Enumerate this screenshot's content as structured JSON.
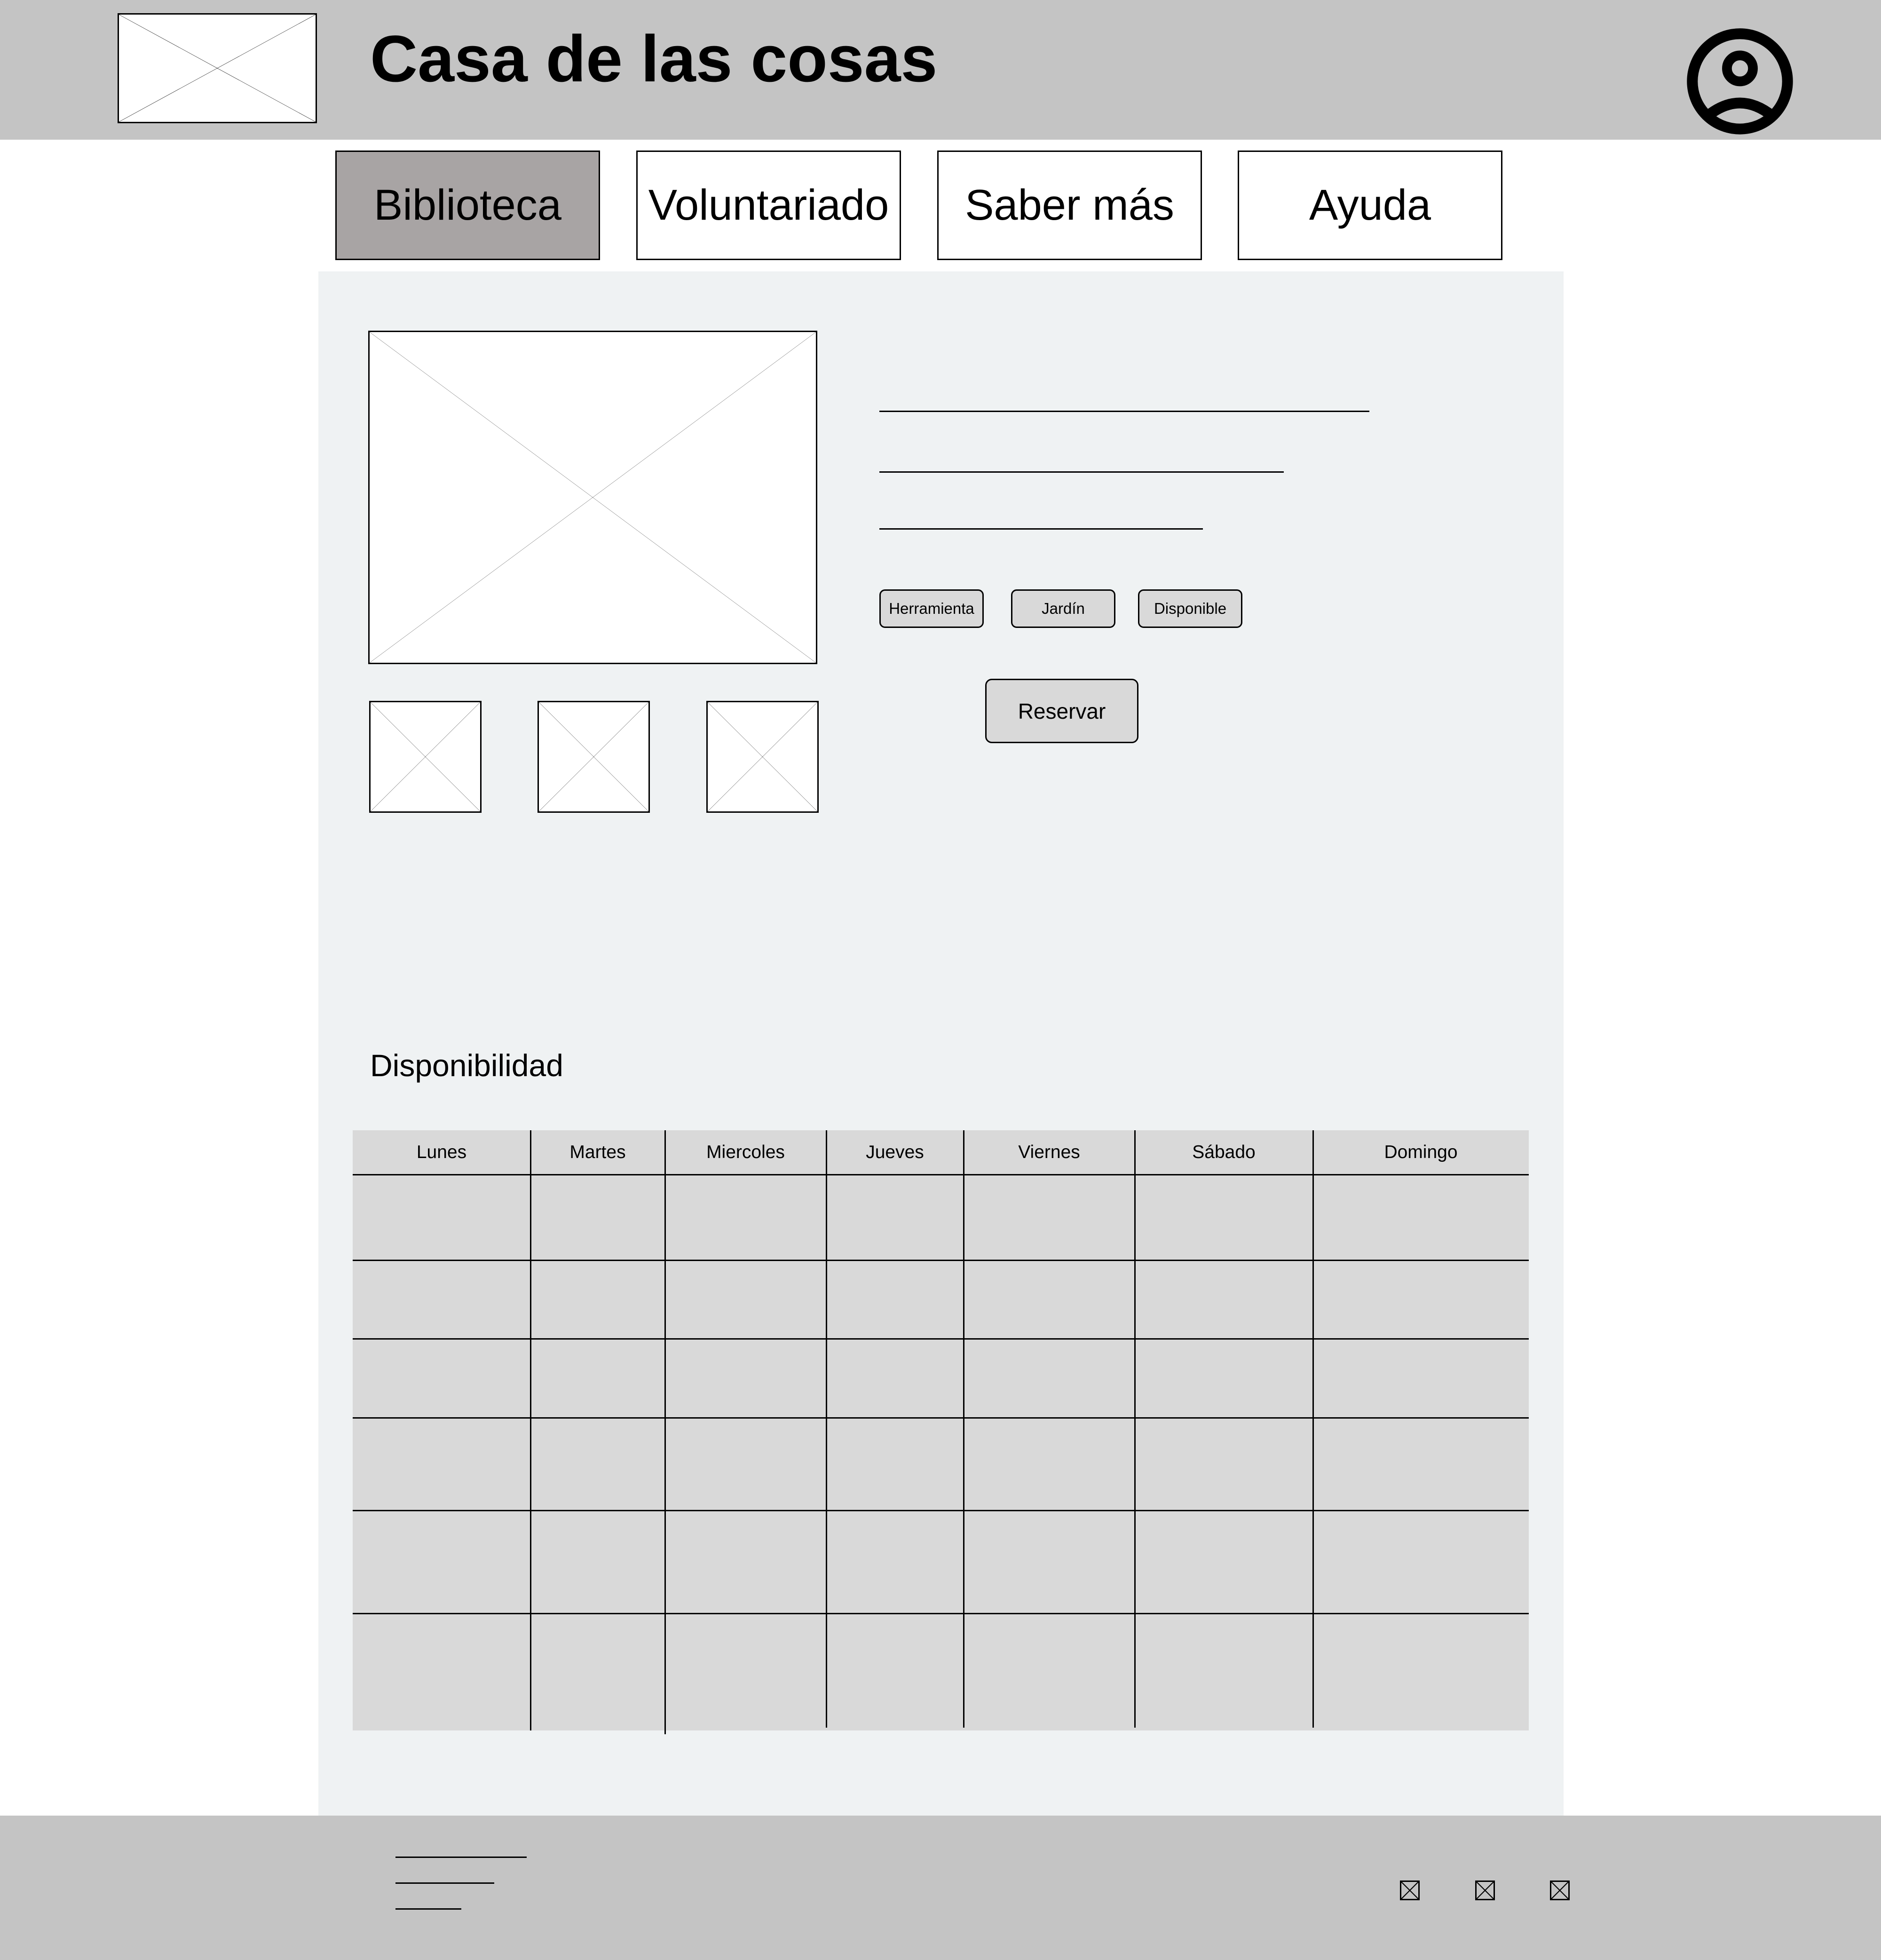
{
  "header": {
    "title": "Casa de las cosas",
    "logo_icon": "image-placeholder-icon",
    "user_icon": "user-account-icon"
  },
  "nav": {
    "tabs": [
      {
        "label": "Biblioteca",
        "active": true
      },
      {
        "label": "Voluntariado",
        "active": false
      },
      {
        "label": "Saber más",
        "active": false
      },
      {
        "label": "Ayuda",
        "active": false
      }
    ]
  },
  "item": {
    "tags": [
      "Herramienta",
      "Jardín",
      "Disponible"
    ],
    "reserve_label": "Reservar"
  },
  "availability": {
    "title": "Disponibilidad",
    "days": [
      "Lunes",
      "Martes",
      "Miercoles",
      "Jueves",
      "Viernes",
      "Sábado",
      "Domingo"
    ]
  },
  "colors": {
    "header_bg": "#c4c4c4",
    "active_tab": "#a8a4a4",
    "panel_bg": "#eff2f3",
    "calendar_bg": "#d9d9d9"
  }
}
